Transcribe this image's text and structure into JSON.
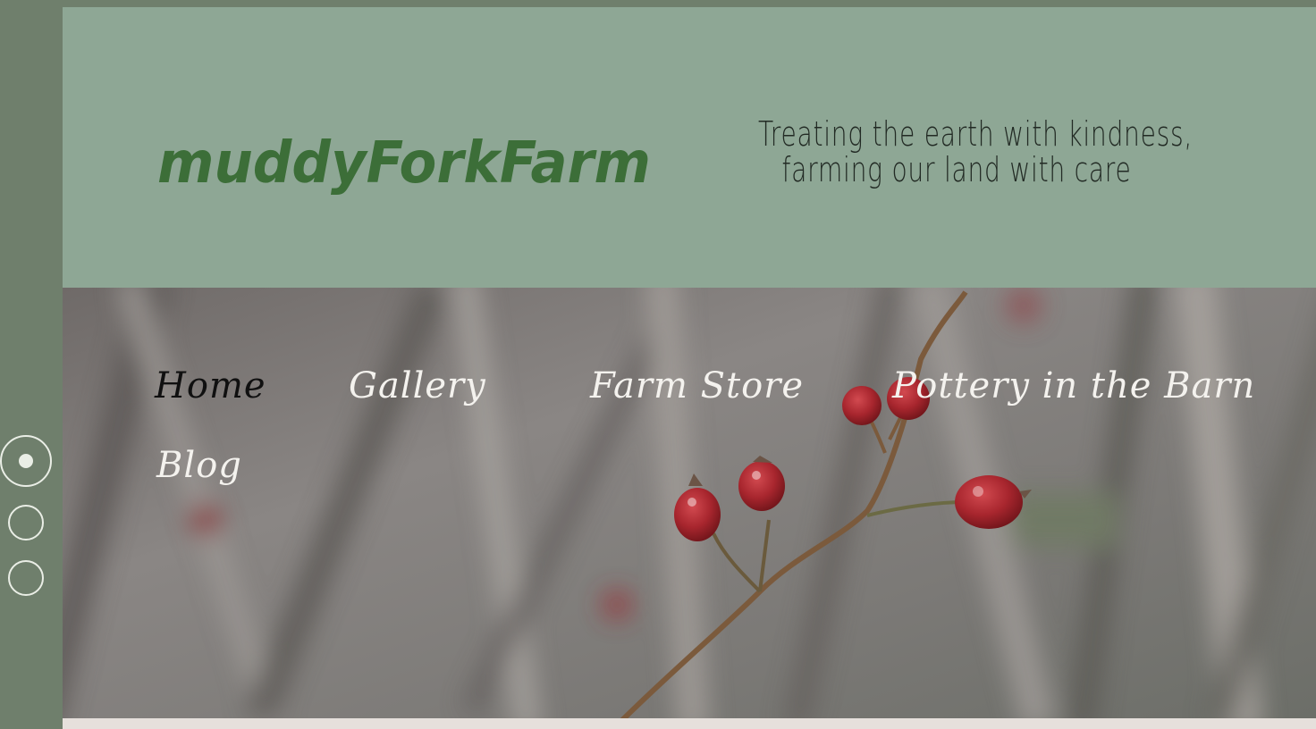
{
  "colors": {
    "rail": "#6f7f6c",
    "header_bg": "#8ea795",
    "logo_green": "#3c6e38",
    "tagline_text": "#222a24",
    "nav_text": "#f4f2ee",
    "nav_active_text": "#101010",
    "footer_strip": "#e6e0dc",
    "berry_red": "#a8262e"
  },
  "header": {
    "logo_text": "muddyForkFarm",
    "tagline_line1": "Treating the earth with kindness,",
    "tagline_line2": "farming our land with care"
  },
  "nav": {
    "items": [
      {
        "label": "Home",
        "active": true
      },
      {
        "label": "Gallery",
        "active": false
      },
      {
        "label": "Farm Store",
        "active": false
      },
      {
        "label": "Pottery in the Barn",
        "active": false
      },
      {
        "label": "Blog",
        "active": false
      }
    ]
  },
  "slider": {
    "slide_count": 3,
    "active_index": 0
  },
  "hero": {
    "image_subject": "rose-hips-branch"
  }
}
